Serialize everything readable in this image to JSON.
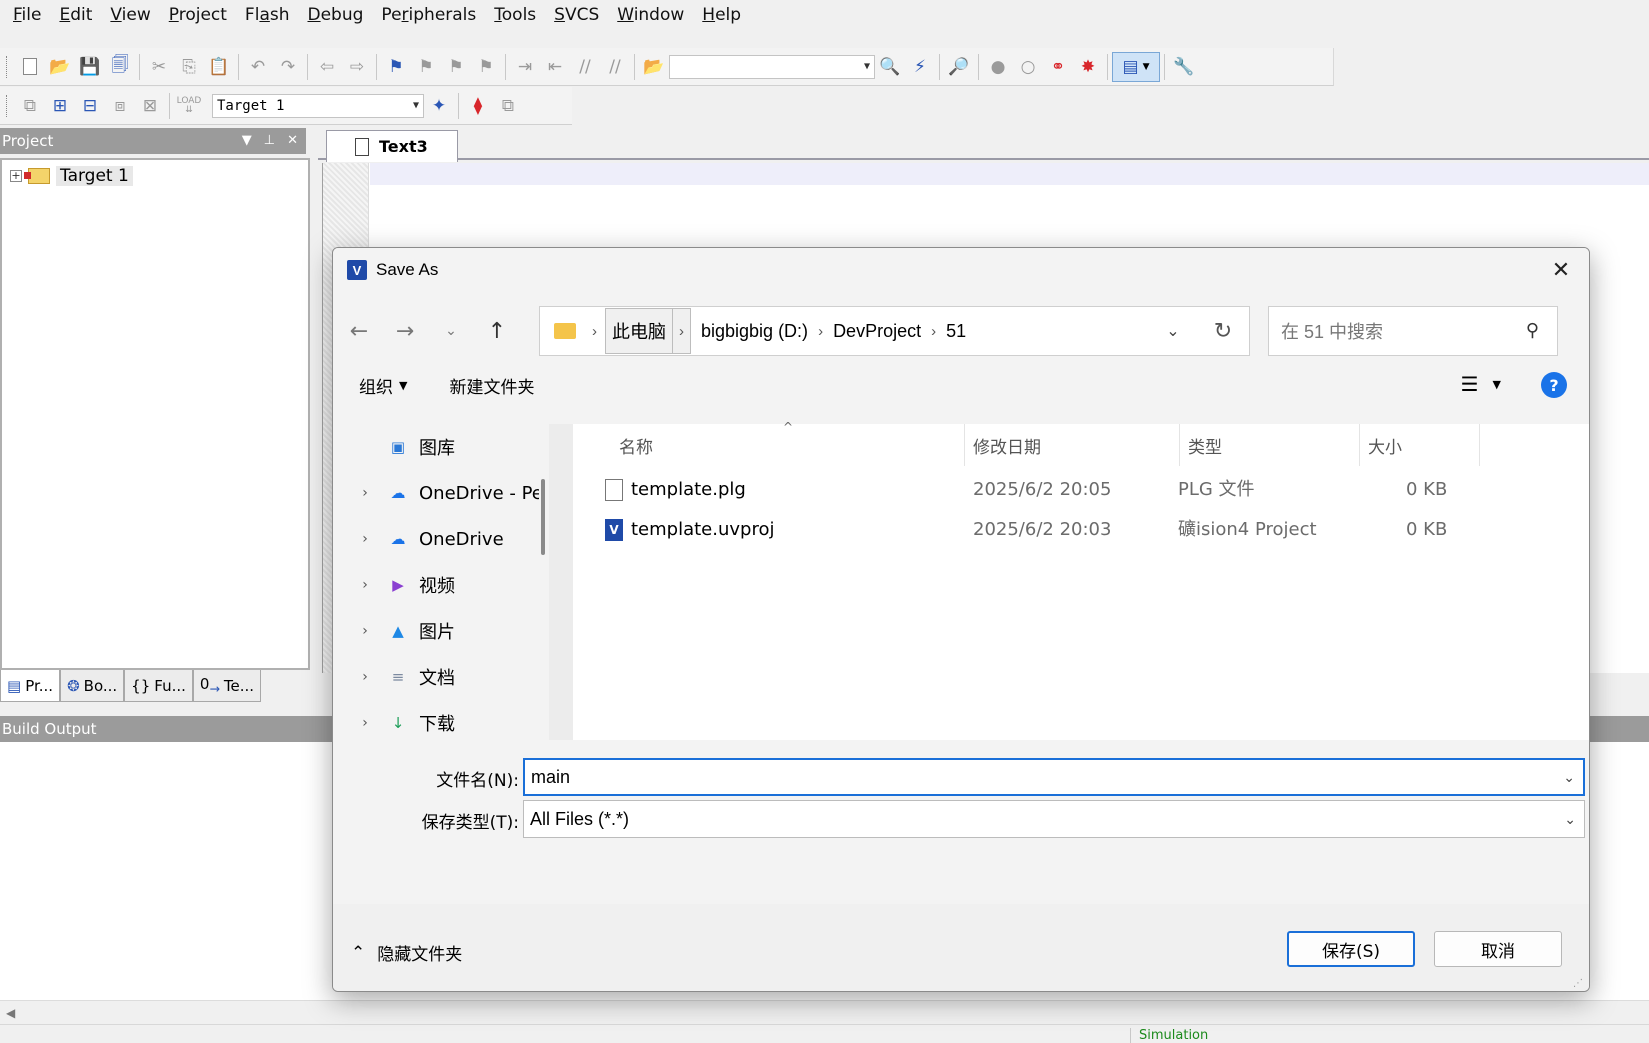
{
  "menu": {
    "items": [
      {
        "pre": "",
        "u": "F",
        "post": "ile"
      },
      {
        "pre": "",
        "u": "E",
        "post": "dit"
      },
      {
        "pre": "",
        "u": "V",
        "post": "iew"
      },
      {
        "pre": "",
        "u": "P",
        "post": "roject"
      },
      {
        "pre": "Fl",
        "u": "a",
        "post": "sh"
      },
      {
        "pre": "",
        "u": "D",
        "post": "ebug"
      },
      {
        "pre": "Pe",
        "u": "r",
        "post": "ipherals"
      },
      {
        "pre": "",
        "u": "T",
        "post": "ools"
      },
      {
        "pre": "",
        "u": "S",
        "post": "VCS"
      },
      {
        "pre": "",
        "u": "W",
        "post": "indow"
      },
      {
        "pre": "",
        "u": "H",
        "post": "elp"
      }
    ]
  },
  "toolbar2": {
    "target_select": "Target 1",
    "load_label": "LOAD"
  },
  "project_panel": {
    "title": "Project",
    "tree_root": "Target 1",
    "tabs": [
      "Pr...",
      "Bo...",
      "Fu...",
      "Te..."
    ]
  },
  "editor": {
    "tab_label": "Text3"
  },
  "build_output": {
    "title": "Build Output"
  },
  "status": {
    "mode": "Simulation"
  },
  "dialog": {
    "title": "Save As",
    "address": {
      "crumbs": [
        "此电脑",
        "bigbigbig (D:)",
        "DevProject",
        "51"
      ]
    },
    "search_placeholder": "在 51 中搜索",
    "commands": {
      "organize": "组织",
      "new_folder": "新建文件夹"
    },
    "nav_items": [
      {
        "label": "图库",
        "icon": "gallery-icon",
        "chevron": false
      },
      {
        "label": "OneDrive - Pe",
        "icon": "onedrive-icon",
        "chevron": true
      },
      {
        "label": "OneDrive",
        "icon": "onedrive-icon",
        "chevron": true
      },
      {
        "label": "视频",
        "icon": "videos-icon",
        "chevron": true
      },
      {
        "label": "图片",
        "icon": "pictures-icon",
        "chevron": true
      },
      {
        "label": "文档",
        "icon": "documents-icon",
        "chevron": true
      },
      {
        "label": "下载",
        "icon": "downloads-icon",
        "chevron": true
      }
    ],
    "columns": [
      "名称",
      "修改日期",
      "类型",
      "大小"
    ],
    "files": [
      {
        "name": "template.plg",
        "date": "2025/6/2 20:05",
        "type": "PLG 文件",
        "size": "0 KB",
        "icon": "document-icon"
      },
      {
        "name": "template.uvproj",
        "date": "2025/6/2 20:03",
        "type": "礦ision4 Project",
        "size": "0 KB",
        "icon": "uvision-project-icon"
      }
    ],
    "filename_label": "文件名(N):",
    "filename_value": "main",
    "filetype_label": "保存类型(T):",
    "filetype_value": "All Files (*.*)",
    "hide_folders": "隐藏文件夹",
    "save_button": "保存(S)",
    "cancel_button": "取消"
  },
  "colors": {
    "accent": "#1a6fd8",
    "panel_header": "#9b9b9b",
    "status_green": "#1c8a1c"
  }
}
